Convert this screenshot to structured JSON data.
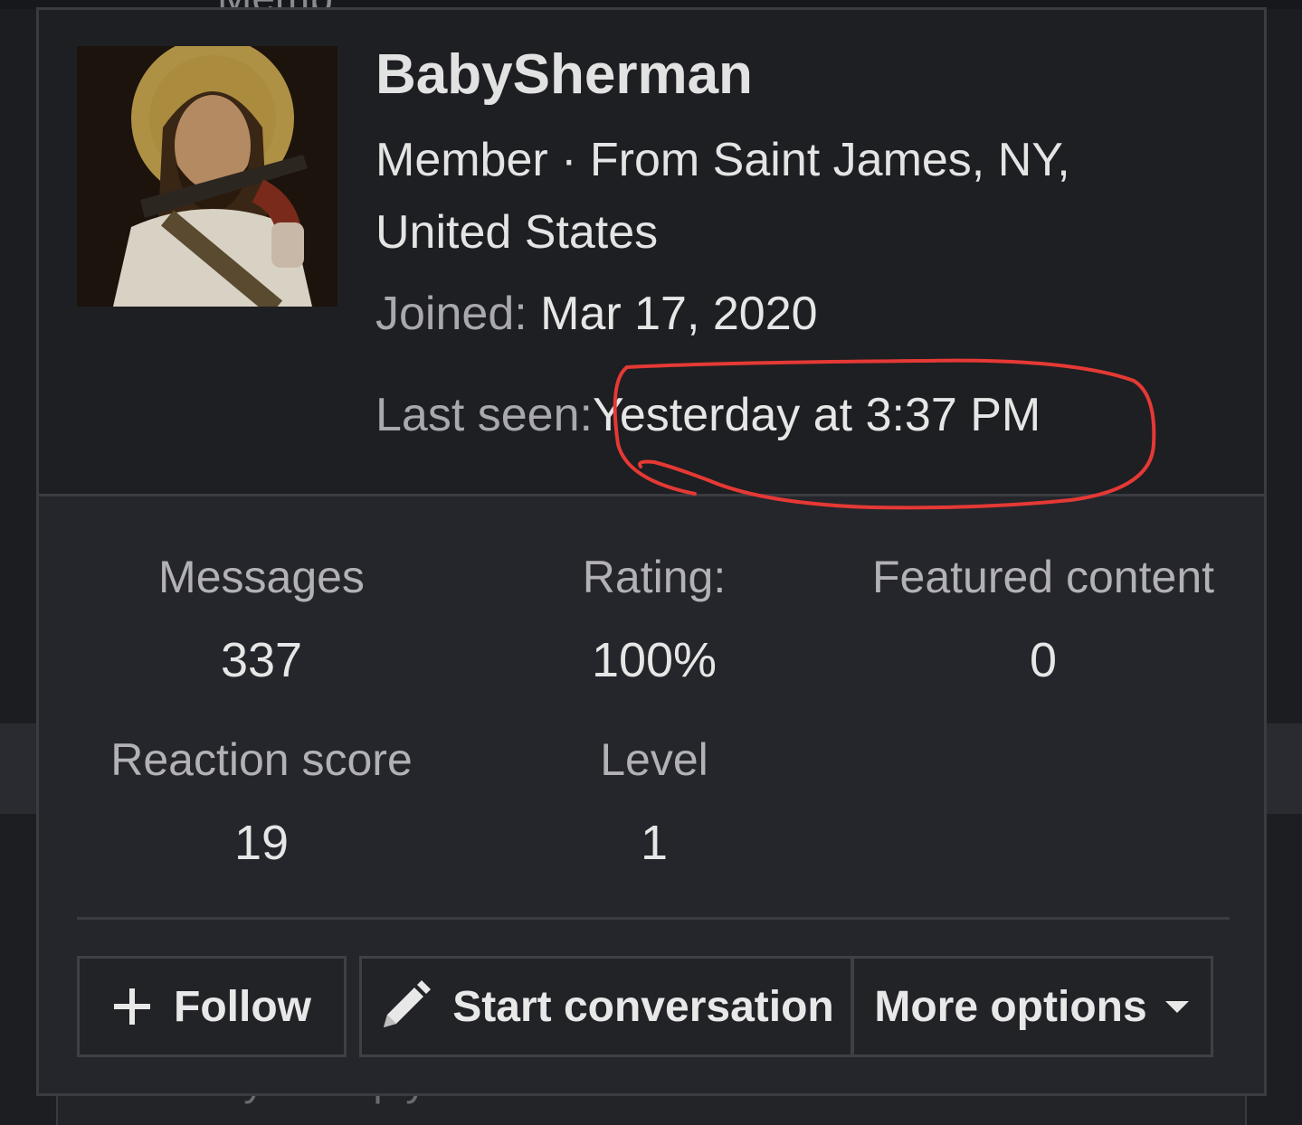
{
  "background": {
    "top_fragment": "Memb",
    "reply_placeholder": "Write your reply..."
  },
  "profile": {
    "username": "BabySherman",
    "member_line": "Member · From Saint James, NY, United States",
    "joined_label": "Joined:",
    "joined_value": "Mar 17, 2020",
    "last_seen_label": "Last seen:",
    "last_seen_value": "Yesterday at 3:37 PM",
    "annotation_color": "#e53935"
  },
  "stats": {
    "messages_label": "Messages",
    "messages_value": "337",
    "rating_label": "Rating:",
    "rating_value": "100%",
    "featured_label": "Featured content",
    "featured_value": "0",
    "reaction_label": "Reaction score",
    "reaction_value": "19",
    "level_label": "Level",
    "level_value": "1"
  },
  "actions": {
    "follow_label": "Follow",
    "start_conversation_label": "Start conversation",
    "more_options_label": "More options"
  },
  "icons": {
    "follow": "plus-icon",
    "start_conversation": "pencil-icon",
    "more_options": "caret-down-icon"
  },
  "colors": {
    "card_bg": "#25262b",
    "header_bg": "#1e1f22",
    "border": "#3b3c42",
    "text": "#e6e6e6",
    "muted": "#a9a9ad"
  }
}
